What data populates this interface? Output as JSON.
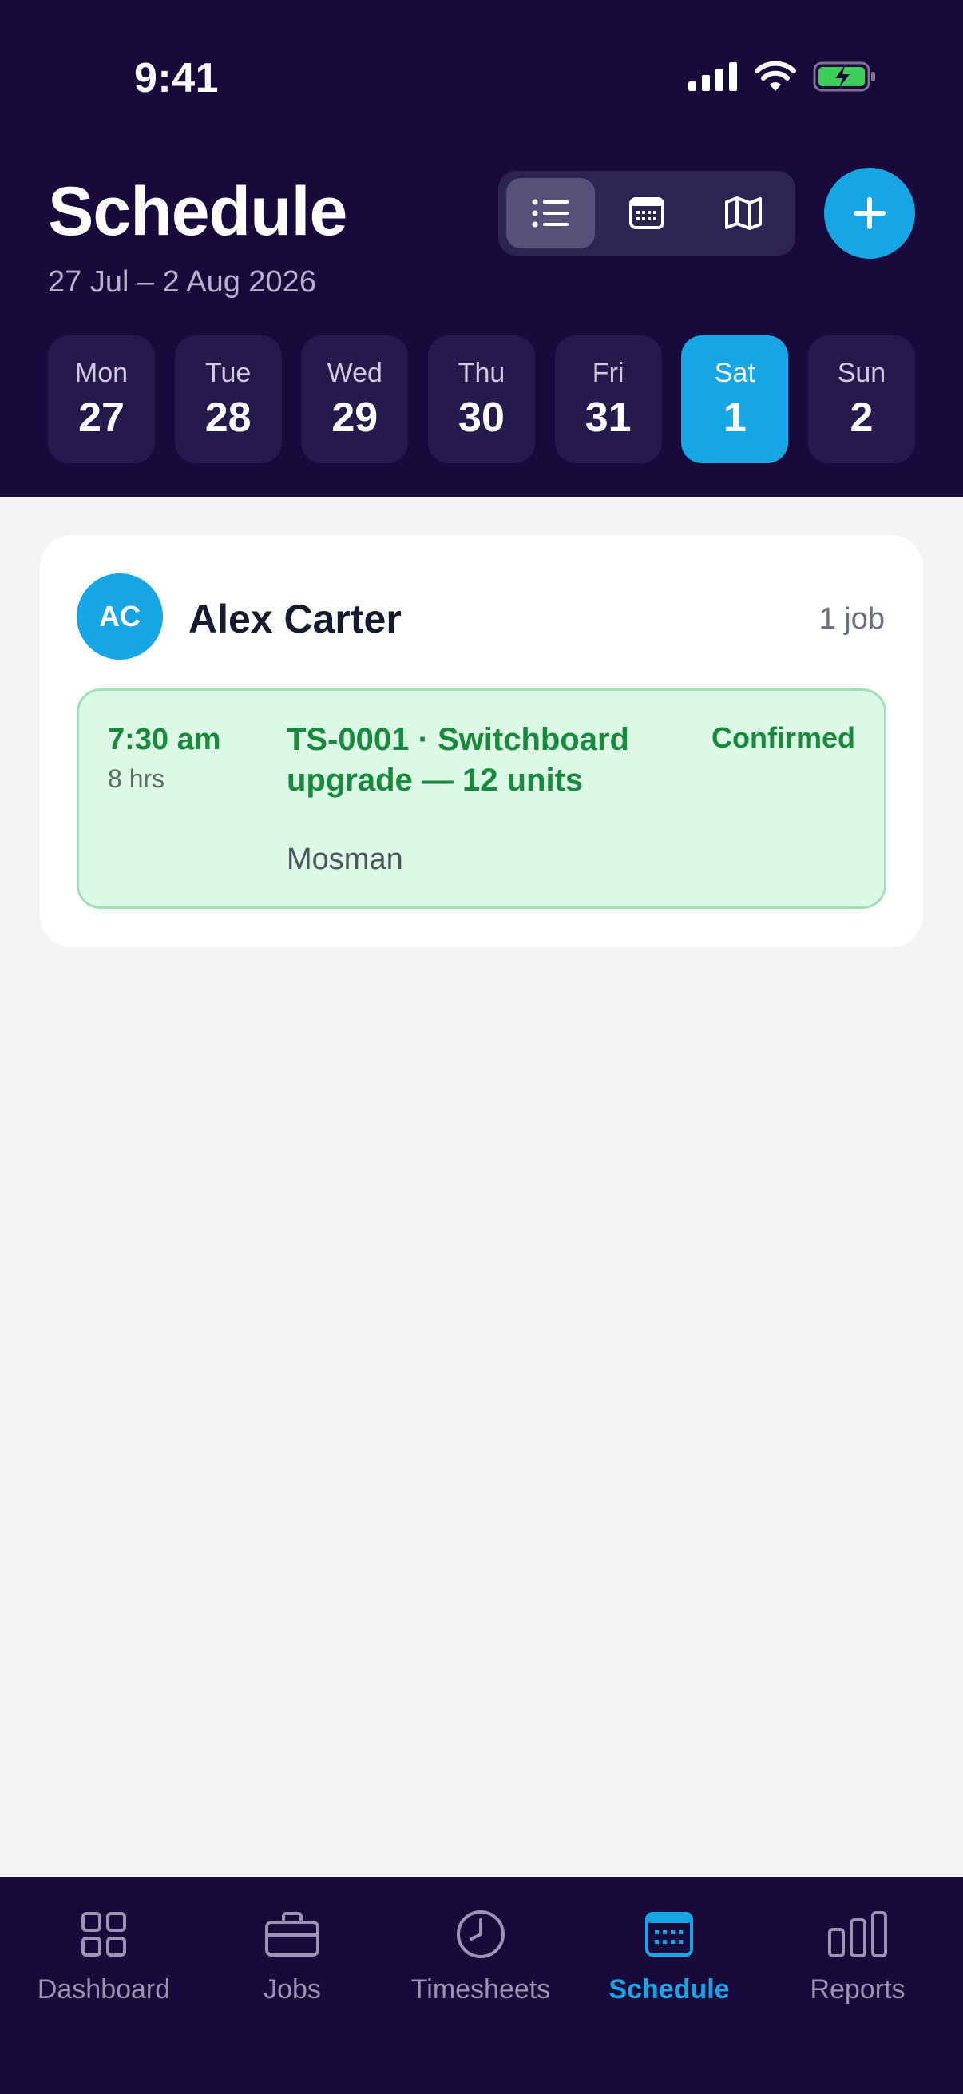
{
  "status_bar": {
    "time": "9:41"
  },
  "header": {
    "title": "Schedule",
    "date_range": "27 Jul – 2 Aug 2026",
    "view_modes": [
      "list-icon",
      "calendar-icon",
      "map-icon"
    ],
    "active_view": "list",
    "add_icon": "plus-icon"
  },
  "days": [
    {
      "name": "Mon",
      "num": "27"
    },
    {
      "name": "Tue",
      "num": "28"
    },
    {
      "name": "Wed",
      "num": "29"
    },
    {
      "name": "Thu",
      "num": "30"
    },
    {
      "name": "Fri",
      "num": "31"
    },
    {
      "name": "Sat",
      "num": "1",
      "selected": true
    },
    {
      "name": "Sun",
      "num": "2"
    }
  ],
  "crew": {
    "initials": "AC",
    "name": "Alex Carter",
    "job_count": "1 job"
  },
  "job": {
    "time": "7:30 am",
    "duration": "8 hrs",
    "title": "TS-0001 · Switchboard upgrade — 12 units",
    "location": "Mosman",
    "status": "Confirmed"
  },
  "nav": [
    {
      "label": "Dashboard",
      "icon": "grid-icon"
    },
    {
      "label": "Jobs",
      "icon": "briefcase-icon"
    },
    {
      "label": "Timesheets",
      "icon": "clock-icon"
    },
    {
      "label": "Schedule",
      "icon": "calendar-icon",
      "active": true
    },
    {
      "label": "Reports",
      "icon": "bar-chart-icon"
    }
  ],
  "colors": {
    "header_bg": "#180b3b",
    "accent": "#16a6e6",
    "confirmed_green": "#178a3e",
    "job_bg": "#dcf9e6"
  }
}
